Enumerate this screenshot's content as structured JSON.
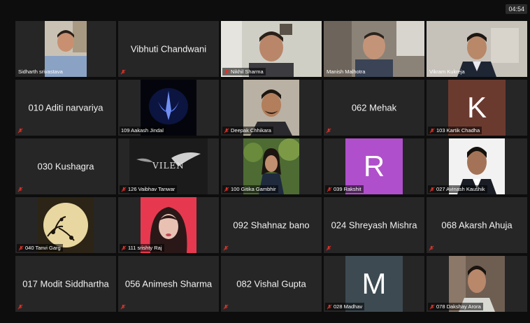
{
  "timer": "04:54",
  "colors": {
    "active_speaker_border": "#c3d65a",
    "tile_bg": "#262626",
    "muted_icon": "#d9332b"
  },
  "participants": {
    "sidharth": {
      "label": "Sidharth srivastava"
    },
    "vibhuti": {
      "name": "Vibhuti Chandwani"
    },
    "nikhil": {
      "label": "Nikhil Sharma"
    },
    "manish": {
      "label": "Manish Malhotra"
    },
    "vikram": {
      "label": "Vikram Kukreja"
    },
    "aditi": {
      "name": "010 Aditi narvariya"
    },
    "aakash": {
      "label": "109 Aakash Jindal"
    },
    "deepak": {
      "label": "Deepak Chhikara"
    },
    "mehak": {
      "name": "062 Mehak"
    },
    "kartik": {
      "initial": "K",
      "label": "103 Kartik Chadha",
      "avatar_color": "#6b3a2f"
    },
    "kushagra": {
      "name": "030 Kushagra"
    },
    "vaibhav": {
      "label": "126 Vaibhav Tanwar",
      "logo_text": "VILEN"
    },
    "gitika": {
      "label": "100 Gitika Gambhir"
    },
    "rakshit": {
      "initial": "R",
      "label": "039 Rakshit",
      "avatar_color": "#b04fcb"
    },
    "avinash": {
      "label": "027 Avinash Kaushik"
    },
    "tanvi": {
      "label": "040 Tanvi Garg"
    },
    "srishty": {
      "label": "111 srishty Raj"
    },
    "shahnaz": {
      "name": "092 Shahnaz bano"
    },
    "shreyash": {
      "name": "024 Shreyash Mishra"
    },
    "akarsh": {
      "name": "068 Akarsh Ahuja"
    },
    "modit": {
      "name": "017 Modit Siddhartha"
    },
    "animesh": {
      "name": "056 Animesh Sharma"
    },
    "vishal": {
      "name": "082 Vishal Gupta"
    },
    "madhav": {
      "initial": "M",
      "label": "028 Madhav",
      "avatar_color": "#3d4a52"
    },
    "dakshay": {
      "label": "078 Dakshay Arora"
    }
  }
}
